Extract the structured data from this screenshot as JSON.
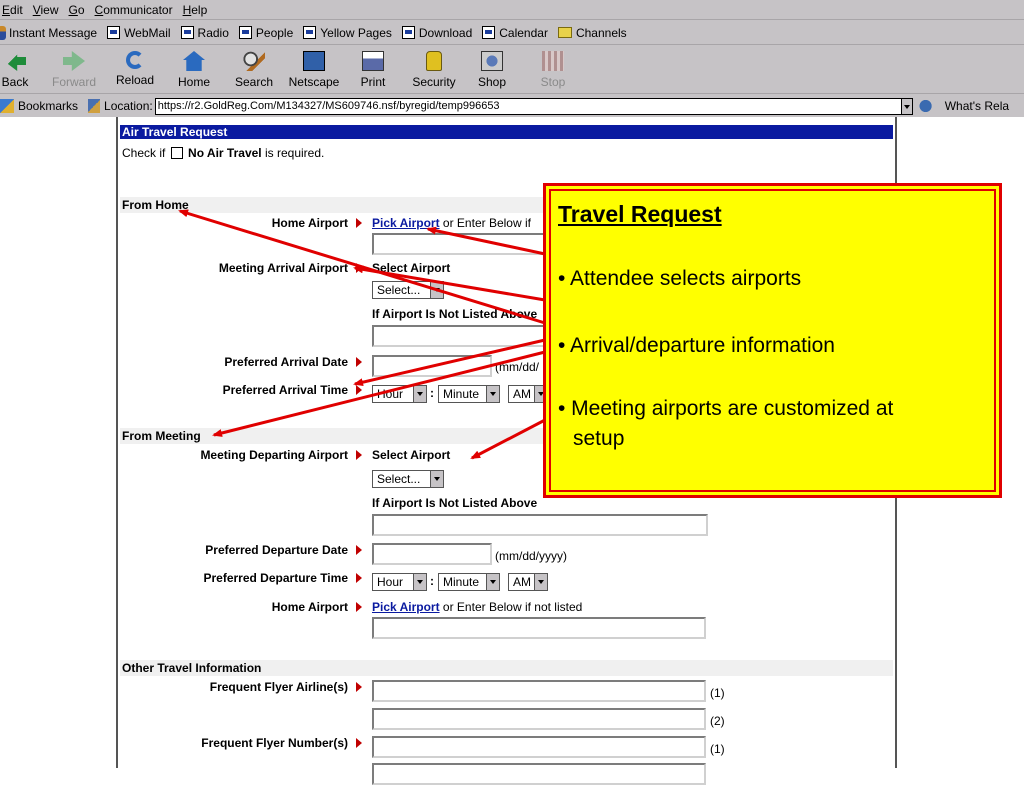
{
  "menubar": {
    "items": [
      {
        "label": "Edit",
        "ul": "E",
        "rest": "dit"
      },
      {
        "label": "View",
        "ul": "V",
        "rest": "iew"
      },
      {
        "label": "Go",
        "ul": "G",
        "rest": "o"
      },
      {
        "label": "Communicator",
        "ul": "C",
        "rest": "ommunicator"
      },
      {
        "label": "Help",
        "ul": "H",
        "rest": "elp"
      }
    ]
  },
  "personal_toolbar": {
    "items": [
      "Instant Message",
      "WebMail",
      "Radio",
      "People",
      "Yellow Pages",
      "Download",
      "Calendar",
      "Channels"
    ]
  },
  "nav_toolbar": {
    "back": "Back",
    "forward": "Forward",
    "reload": "Reload",
    "home": "Home",
    "search": "Search",
    "netscape": "Netscape",
    "print": "Print",
    "security": "Security",
    "shop": "Shop",
    "stop": "Stop"
  },
  "location_bar": {
    "bookmarks": "Bookmarks",
    "location_label": "Location:",
    "url": "https://r2.GoldReg.Com/M134327/MS609746.nsf/byregid/temp996653",
    "whats_related": "What's Rela"
  },
  "form": {
    "title": "Air Travel Request",
    "check_prefix": "Check if",
    "check_bold": "No Air Travel",
    "check_suffix": "is required.",
    "from_home": {
      "heading": "From Home",
      "home_airport_label": "Home Airport",
      "pick_airport": "Pick Airport",
      "pick_suffix": "or Enter Below if",
      "meeting_arrival_label": "Meeting Arrival Airport",
      "select_airport": "Select Airport",
      "select_value": "Select...",
      "not_listed": "If Airport Is Not Listed Above",
      "arrival_date_label": "Preferred Arrival Date",
      "date_hint": "(mm/dd/",
      "arrival_time_label": "Preferred Arrival Time",
      "hour": "Hour",
      "minute": "Minute",
      "ampm": "AM"
    },
    "from_meeting": {
      "heading": "From Meeting",
      "departing_label": "Meeting Departing Airport",
      "select_airport": "Select Airport",
      "select_value": "Select...",
      "not_listed": "If Airport Is Not Listed Above",
      "departure_date_label": "Preferred Departure Date",
      "date_hint": "(mm/dd/yyyy)",
      "departure_time_label": "Preferred Departure Time",
      "hour": "Hour",
      "minute": "Minute",
      "ampm": "AM",
      "home_airport_label": "Home Airport",
      "pick_airport": "Pick Airport",
      "pick_suffix": "or Enter Below if not listed"
    },
    "other": {
      "heading": "Other Travel Information",
      "ff_airline_label": "Frequent Flyer Airline(s)",
      "ff_number_label": "Frequent Flyer Number(s)",
      "n1": "(1)",
      "n2": "(2)"
    },
    "colon": ":"
  },
  "callout": {
    "title": "Travel Request",
    "bullets": [
      "• Attendee selects airports",
      "• Arrival/departure information",
      "• Meeting airports are customized at",
      "setup"
    ],
    "fill_color": "#ffff00",
    "border_color": "#e00000"
  }
}
